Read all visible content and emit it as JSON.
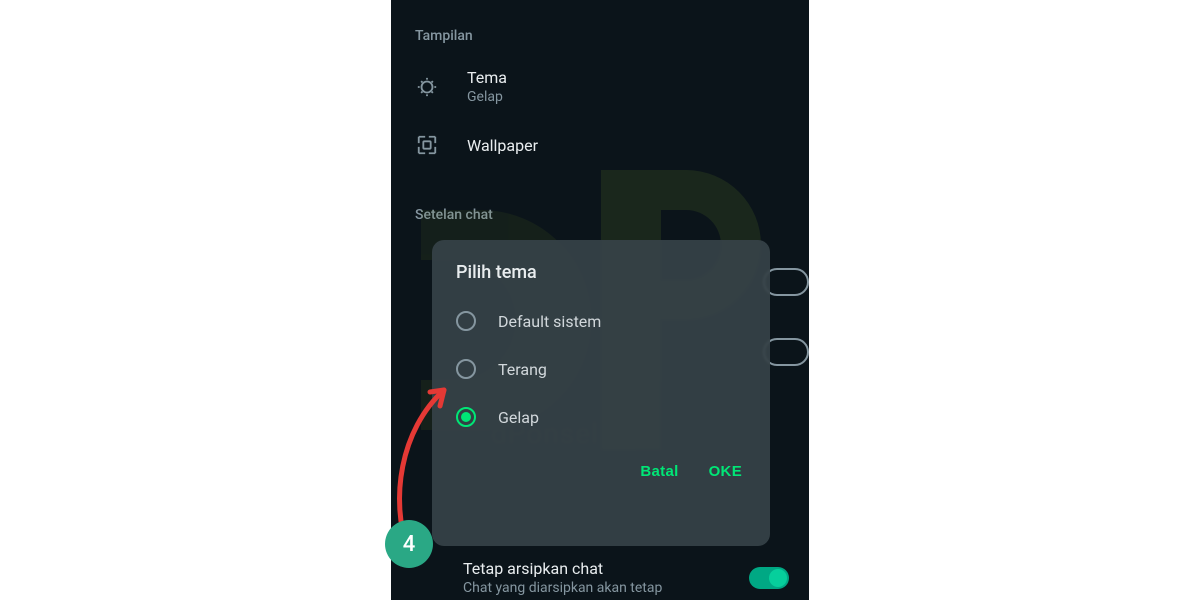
{
  "sections": {
    "display": "Tampilan",
    "theme": {
      "title": "Tema",
      "value": "Gelap"
    },
    "wallpaper": "Wallpaper",
    "chat_settings": "Setelan chat"
  },
  "dialog": {
    "title": "Pilih tema",
    "options": {
      "default": "Default sistem",
      "light": "Terang",
      "dark": "Gelap"
    },
    "buttons": {
      "cancel": "Batal",
      "ok": "OKE"
    }
  },
  "archive": {
    "title": "Tetap arsipkan chat",
    "subtitle": "Chat yang diarsipkan akan tetap"
  },
  "step_badge": "4",
  "watermark_label": "dPonsel"
}
